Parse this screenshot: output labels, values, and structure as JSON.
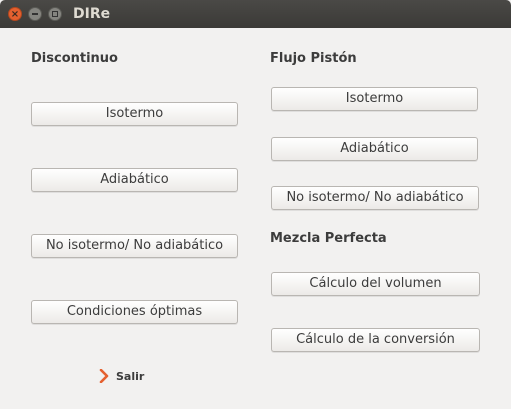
{
  "window": {
    "title": "DIRe",
    "controls": {
      "close_icon": "close-icon",
      "minimize_icon": "minimize-icon",
      "maximize_icon": "maximize-icon"
    }
  },
  "discontinuo": {
    "heading": "Discontinuo",
    "buttons": [
      "Isotermo",
      "Adiabático",
      "No isotermo/ No adiabático",
      "Condiciones óptimas"
    ]
  },
  "flujo_piston": {
    "heading": "Flujo Pistón",
    "buttons": [
      "Isotermo",
      "Adiabático",
      "No isotermo/ No adiabático"
    ]
  },
  "mezcla_perfecta": {
    "heading": "Mezcla Perfecta",
    "buttons": [
      "Cálculo del volumen",
      "Cálculo de la conversión"
    ]
  },
  "exit": {
    "label": "Salir",
    "icon": "chevron-right-icon"
  },
  "colors": {
    "accent": "#e5602f",
    "titlebar": "#3c3b37",
    "background": "#f2f1f0"
  }
}
